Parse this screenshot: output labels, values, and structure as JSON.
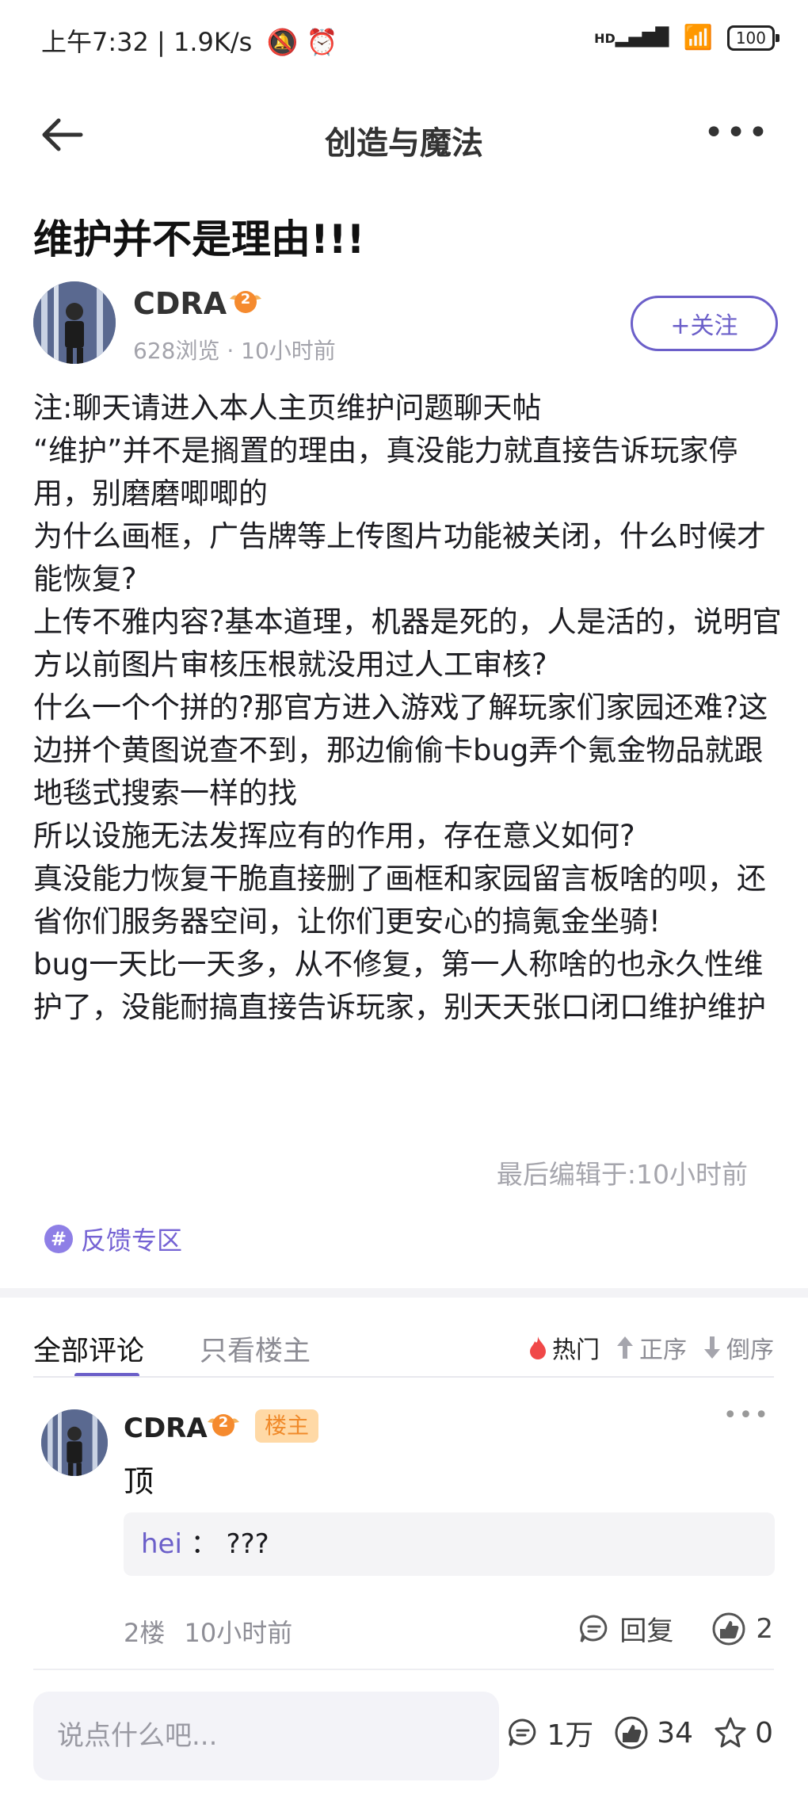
{
  "status_bar": {
    "time": "上午7:32",
    "speed": "1.9K/s",
    "network": "HD",
    "battery": "100"
  },
  "nav": {
    "title": "创造与魔法"
  },
  "post": {
    "title": "维护并不是理由!!!",
    "author": {
      "name": "CDRA",
      "level": "2",
      "views": "628浏览",
      "time": "10小时前"
    },
    "follow_label": "+关注",
    "body": [
      "注:聊天请进入本人主页维护问题聊天帖",
      "“维护”并不是搁置的理由，真没能力就直接告诉玩家停用，别磨磨唧唧的",
      "为什么画框，广告牌等上传图片功能被关闭，什么时候才能恢复?",
      "上传不雅内容?基本道理，机器是死的，人是活的，说明官方以前图片审核压根就没用过人工审核?",
      "什么一个个拼的?那官方进入游戏了解玩家们家园还难?这边拼个黄图说查不到，那边偷偷卡bug弄个氪金物品就跟地毯式搜索一样的找",
      "所以设施无法发挥应有的作用，存在意义如何?",
      "真没能力恢复干脆直接删了画框和家园留言板啥的呗，还省你们服务器空间，让你们更安心的搞氪金坐骑!",
      "bug一天比一天多，从不修复，第一人称啥的也永久性维护了，没能耐搞直接告诉玩家，别天天张口闭口维护维护"
    ],
    "edited": "最后编辑于:10小时前",
    "tag": "反馈专区"
  },
  "comments_section": {
    "tabs": [
      "全部评论",
      "只看楼主"
    ],
    "sorts": [
      "热门",
      "正序",
      "倒序"
    ],
    "comment": {
      "name": "CDRA",
      "level": "2",
      "badge": "楼主",
      "text": "顶",
      "reply_user": "hei",
      "reply_sep": "：",
      "reply_text": "???",
      "floor": "2楼",
      "time": "10小时前",
      "reply_label": "回复",
      "likes": "2"
    }
  },
  "bottom_bar": {
    "placeholder": "说点什么吧...",
    "comments": "1万",
    "likes": "34",
    "stars": "0"
  }
}
